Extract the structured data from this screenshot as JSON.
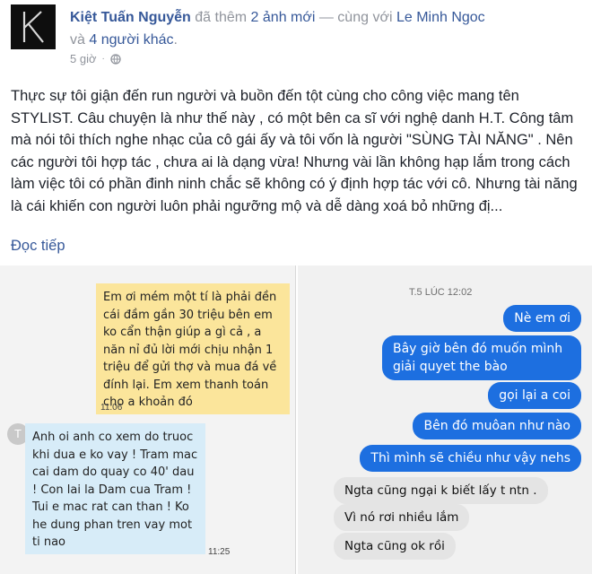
{
  "post": {
    "author": "Kiệt Tuấn Nguyễn",
    "action": "đã thêm",
    "photos": "2 ảnh mới",
    "with_prefix": "— cùng với",
    "tagged": "Le Minh Ngoc",
    "and": "và",
    "others": "4 người khác",
    "period": ".",
    "time": "5 giờ",
    "meta_dot": "·",
    "body": "Thực sự tôi giận đến run người và buồn đến tột cùng cho công việc mang tên STYLIST. Câu chuyện là như thế này , có một bên ca sĩ với nghệ danh H.T. Công tâm mà nói tôi thích nghe nhạc của cô gái ấy và tôi vốn là người \"SÙNG TÀI NĂNG\" . Nên các người tôi hợp tác , chưa ai là dạng vừa! Nhưng vài lần không hạp lắm trong cách làm việc tôi có phần đinh ninh chắc sẽ không có ý định hợp tác với cô. Nhưng tài năng là cái khiến con người luôn phải ngưỡng mộ và dễ dàng xoá bỏ những đị...",
    "read_more": "Đọc tiếp"
  },
  "left_screenshot": {
    "yellow_message": "Em ơi mém một tí là phải đền cái đầm gần 30 triệu bên em ko cẩn thận giúp a gì cả , a năn nỉ đủ lời mới chịu nhận 1 triệu để gửi thợ và mua đá về đính lại. Em xem thanh toán cho a khoản đó",
    "yellow_time": "11:06",
    "contact_initial": "T",
    "blue_message": "Anh oi anh co xem do truoc khi dua e ko vay ! Tram mac cai dam do quay co 40' dau ! Con lai la Dam cua Tram ! Tui e mac rat can than ! Ko he dung phan tren vay mot ti nao",
    "blue_time": "11:25"
  },
  "right_screenshot": {
    "date": "T.5 LÚC 12:02",
    "sent": [
      "Nè em ơi",
      "Bây giờ bên đó muốn mình giải quyet the bào",
      "gọi lại a coi",
      "Bên đó muôan như nào",
      "Thì mình sẽ chiều như vậy nehs"
    ],
    "received": [
      "Ngta cũng ngại k biết lấy t ntn .",
      "Vì nó rơi nhiều lắm",
      "Ngta cũng ok rồi"
    ]
  }
}
